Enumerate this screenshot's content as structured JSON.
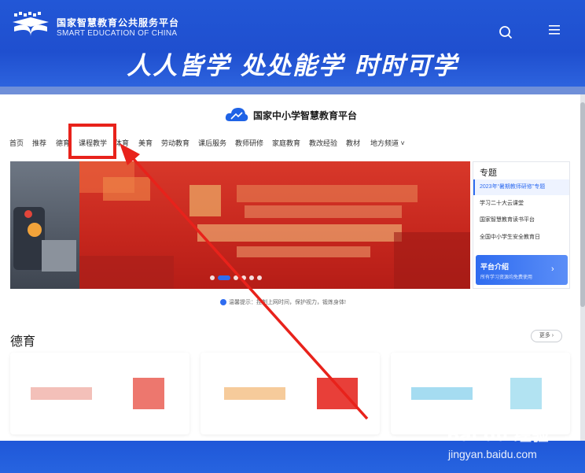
{
  "header": {
    "logo_cn": "国家智慧教育公共服务平台",
    "logo_en": "SMART EDUCATION OF CHINA",
    "slogan": "人人皆学 处处能学 时时可学"
  },
  "platform": {
    "title": "国家中小学智慧教育平台"
  },
  "nav": {
    "items": [
      "首页",
      "推荐",
      "德育",
      "课程教学",
      "体育",
      "美育",
      "劳动教育",
      "课后服务",
      "教师研修",
      "家庭教育",
      "教改经验",
      "教材",
      "地方频道 ˅"
    ]
  },
  "carousel": {
    "dot_count": 6,
    "active_dot": 1
  },
  "topics": {
    "title": "专题",
    "items": [
      "2023年“暑期教师研修”专题",
      "学习二十大云课堂",
      "国家智慧教育读书平台",
      "全国中小学生安全教育日"
    ],
    "intro_title": "平台介绍",
    "intro_sub": "所有学习资源均免费使用",
    "intro_arrow": "›"
  },
  "notice": {
    "text": "温馨提示：控制上网时间，保护视力，锻炼身体!"
  },
  "section": {
    "title": "德育",
    "more_label": "更多 ›"
  },
  "watermark": {
    "main": "Bai du 经验",
    "url": "jingyan.baidu.com"
  },
  "colors": {
    "brand_blue": "#2257d6",
    "highlight_red": "#e8221b",
    "accent_blue": "#2f6cf0"
  }
}
